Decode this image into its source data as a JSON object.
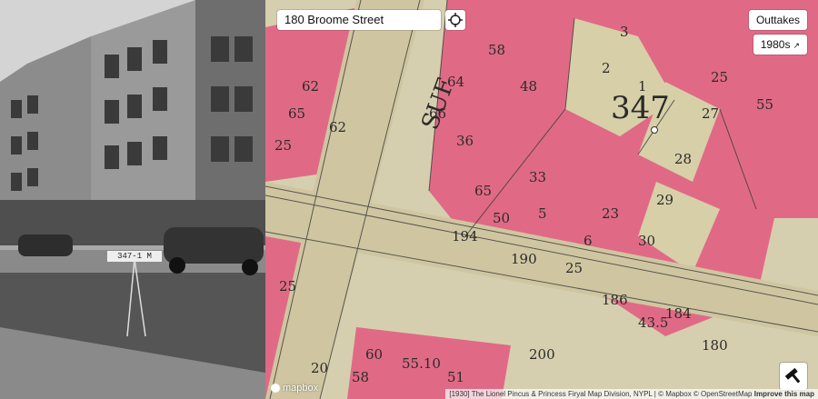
{
  "search": {
    "value": "180 Broome Street"
  },
  "buttons": {
    "outtakes": "Outtakes",
    "year": "1980s"
  },
  "photo": {
    "placard": "347-1 M"
  },
  "map": {
    "block_number": "347",
    "street_label": "SUF",
    "lot_numbers": [
      "25",
      "65",
      "62",
      "62",
      "6",
      "5",
      "20",
      "48",
      "58",
      "66",
      "64",
      "88",
      "3",
      "2",
      "1",
      "33",
      "55",
      "65",
      "27",
      "25",
      "28",
      "29",
      "30",
      "36",
      "50",
      "194",
      "190",
      "25",
      "186",
      "23",
      "184",
      "180",
      "200",
      "60",
      "58",
      "55.10",
      "51",
      "25",
      "30",
      "65",
      "43.5"
    ],
    "mapbox_label": "mapbox",
    "attribution": "[1930] The Lionel Pincus & Princess Firyal Map Division, NYPL | © Mapbox © OpenStreetMap",
    "improve": "Improve this map"
  },
  "icons": {
    "locate": "crosshair-icon",
    "tool": "hammer-icon",
    "external": "external-link-icon"
  }
}
